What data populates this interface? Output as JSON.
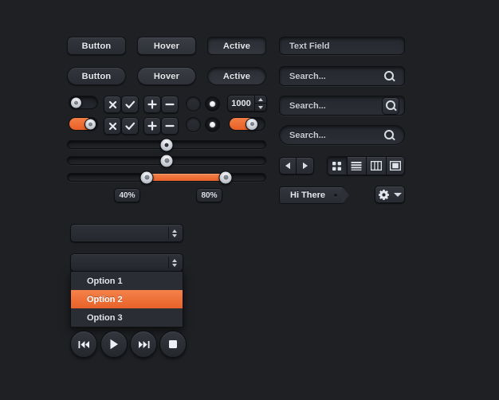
{
  "theme": {
    "background": "#1e2024",
    "accent": "#ef6a2e",
    "text": "#e8eaee",
    "surface": "#2e3138"
  },
  "buttons": {
    "rect_row": [
      {
        "label": "Button",
        "state": "normal"
      },
      {
        "label": "Hover",
        "state": "hover"
      },
      {
        "label": "Active",
        "state": "active"
      }
    ],
    "pill_row": [
      {
        "label": "Button",
        "state": "normal"
      },
      {
        "label": "Hover",
        "state": "hover"
      },
      {
        "label": "Active",
        "state": "active"
      }
    ]
  },
  "fields": {
    "text_field": {
      "value": "Text Field"
    },
    "search_rect": {
      "placeholder": "Search...",
      "icon": "search-icon"
    },
    "search_button": {
      "placeholder": "Search...",
      "icon": "search-icon"
    },
    "search_pill": {
      "placeholder": "Search...",
      "icon": "search-icon"
    }
  },
  "controls": {
    "toggle_off": {
      "state": "off"
    },
    "toggle_on": {
      "state": "on"
    },
    "toggle_wide": {
      "state": "on"
    },
    "icon_buttons_row1": [
      {
        "icon": "close-icon",
        "glyph": "✕"
      },
      {
        "icon": "check-icon",
        "glyph": "✓"
      },
      {
        "icon": "plus-icon",
        "glyph": "+"
      },
      {
        "icon": "minus-icon",
        "glyph": "−"
      }
    ],
    "icon_buttons_row2": [
      {
        "icon": "close-icon",
        "glyph": "✕"
      },
      {
        "icon": "check-icon",
        "glyph": "✓"
      },
      {
        "icon": "plus-icon",
        "glyph": "+"
      },
      {
        "icon": "minus-icon",
        "glyph": "−"
      }
    ],
    "radios_row1": [
      {
        "state": "off"
      },
      {
        "state": "on"
      }
    ],
    "radios_row2": [
      {
        "state": "off"
      },
      {
        "state": "on"
      }
    ],
    "stepper": {
      "value": "1000",
      "up": "stepper-up-arrow",
      "down": "stepper-down-arrow"
    }
  },
  "sliders": {
    "slider_one": {
      "value": 50
    },
    "slider_two": {
      "value": 50
    },
    "range_slider": {
      "min_value": 40,
      "max_value": 80
    },
    "labels": {
      "left": "40%",
      "right": "80%"
    }
  },
  "navigation": {
    "back": {
      "icon": "back-arrow-icon"
    },
    "forward": {
      "icon": "forward-arrow-icon"
    },
    "view_modes": [
      {
        "icon": "grid-view-icon",
        "selected": true
      },
      {
        "icon": "list-view-icon",
        "selected": false
      },
      {
        "icon": "column-view-icon",
        "selected": false
      },
      {
        "icon": "coverflow-view-icon",
        "selected": false
      }
    ]
  },
  "tag": {
    "label": "Hi There"
  },
  "gear_menu": {
    "icon": "gear-icon",
    "caret": "chevron-down-icon"
  },
  "select": {
    "closed": {
      "value": ""
    },
    "open": {
      "value": "",
      "options": [
        {
          "label": "Option 1",
          "selected": false
        },
        {
          "label": "Option 2",
          "selected": true
        },
        {
          "label": "Option 3",
          "selected": false
        }
      ]
    }
  },
  "media_controls": [
    {
      "icon": "previous-track-icon"
    },
    {
      "icon": "play-icon"
    },
    {
      "icon": "next-track-icon"
    },
    {
      "icon": "stop-icon"
    }
  ]
}
